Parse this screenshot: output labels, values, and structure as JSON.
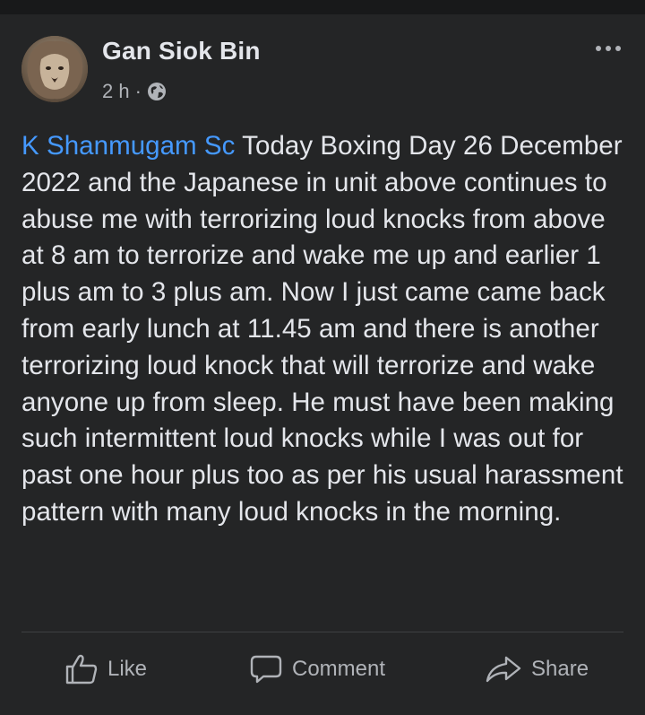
{
  "post": {
    "author": "Gan Siok Bin",
    "time": "2 h",
    "separator": "·",
    "mention": "K Shanmugam Sc",
    "body": " Today Boxing Day 26 December 2022 and the Japanese in unit above continues to abuse me with terrorizing loud knocks from above at 8 am to terrorize and wake me up and earlier 1 plus am to 3 plus am. Now I just came came back from early lunch at 11.45 am and there is another terrorizing loud knock that will terrorize and wake anyone up from sleep. He must have been making such intermittent loud knocks while I was out for past one hour plus too as per his usual harassment pattern with many loud knocks in the morning."
  },
  "actions": {
    "like": "Like",
    "comment": "Comment",
    "share": "Share"
  },
  "icons": {
    "privacy": "globe-icon",
    "menu": "more-options-icon",
    "like": "thumbs-up-icon",
    "comment": "comment-bubble-icon",
    "share": "share-arrow-icon"
  },
  "colors": {
    "background": "#242526",
    "page": "#18191a",
    "text": "#e4e6eb",
    "secondary": "#b0b3b8",
    "mention": "#4599ff"
  }
}
